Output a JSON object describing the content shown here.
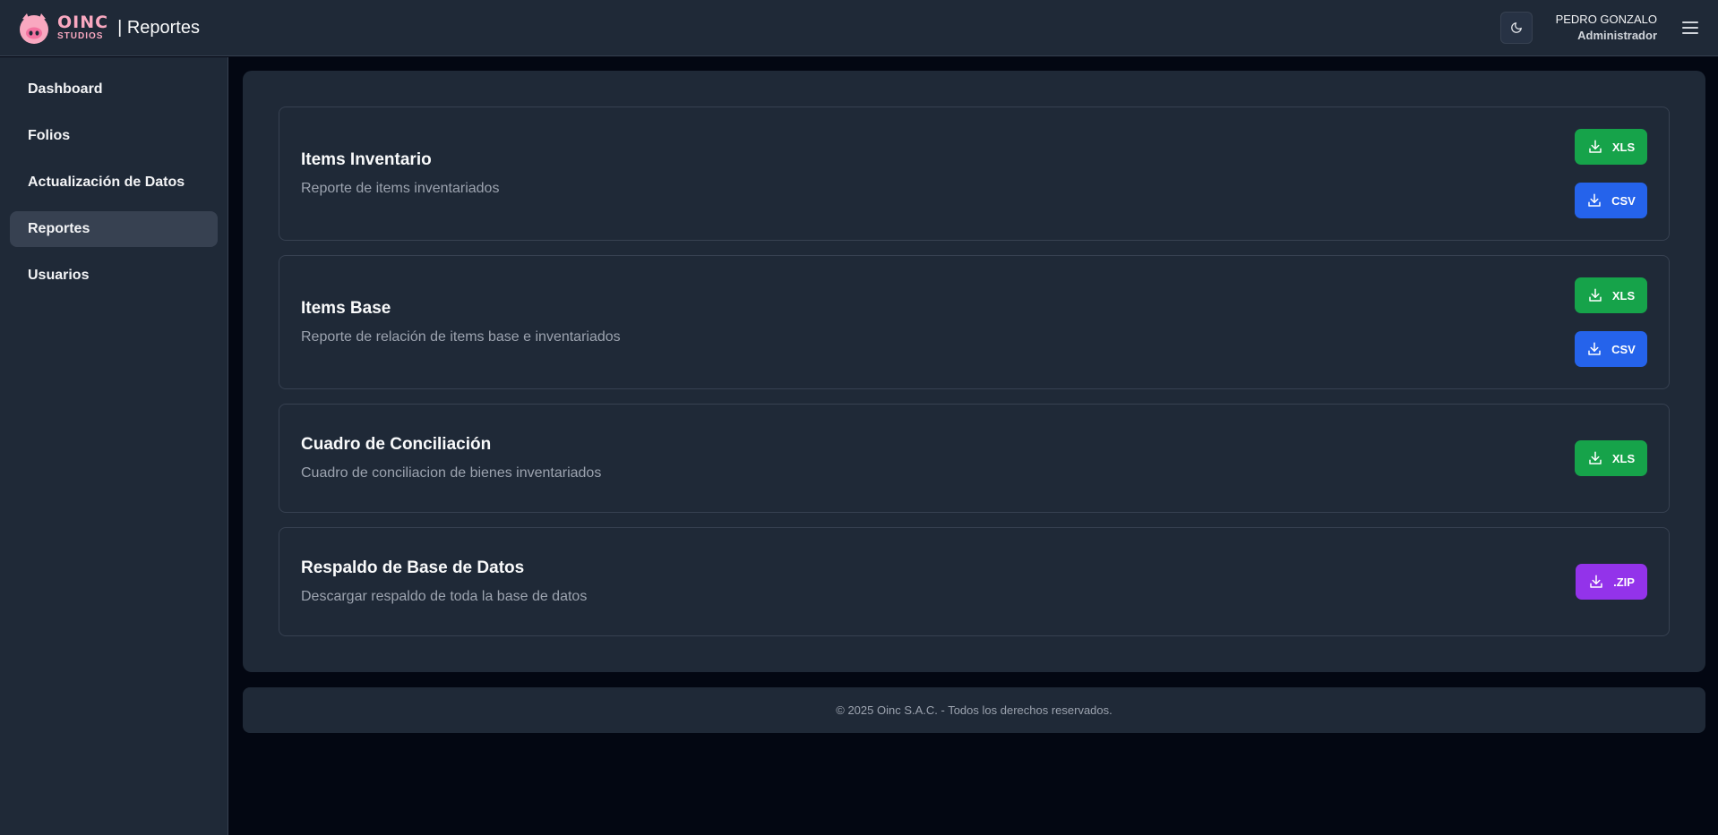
{
  "header": {
    "logo_line1": "OINC",
    "logo_line2": "STUDIOS",
    "title": "| Reportes",
    "user_name": "PEDRO GONZALO",
    "user_role": "Administrador"
  },
  "sidebar": {
    "items": [
      {
        "label": "Dashboard"
      },
      {
        "label": "Folios"
      },
      {
        "label": "Actualización de Datos"
      },
      {
        "label": "Reportes",
        "active": true
      },
      {
        "label": "Usuarios"
      }
    ]
  },
  "reports": [
    {
      "title": "Items Inventario",
      "description": "Reporte de items inventariados",
      "buttons": [
        "XLS",
        "CSV"
      ]
    },
    {
      "title": "Items Base",
      "description": "Reporte de relación de items base e inventariados",
      "buttons": [
        "XLS",
        "CSV"
      ]
    },
    {
      "title": "Cuadro de Conciliación",
      "description": "Cuadro de conciliacion de bienes inventariados",
      "buttons": [
        "XLS"
      ]
    },
    {
      "title": "Respaldo de Base de Datos",
      "description": "Descargar respaldo de toda la base de datos",
      "buttons": [
        ".ZIP"
      ]
    }
  ],
  "footer": {
    "text": "© 2025 Oinc S.A.C. - Todos los derechos reservados."
  },
  "colors": {
    "xls": "#16a34a",
    "csv": "#2563eb",
    "zip": "#9333ea",
    "accent_pink": "#f9a8c0"
  },
  "icons": {
    "theme": "moon-icon",
    "menu": "hamburger-menu-icon",
    "download": "download-icon"
  }
}
